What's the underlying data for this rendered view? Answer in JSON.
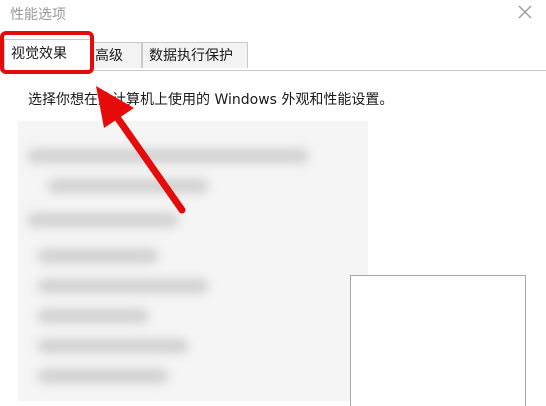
{
  "window": {
    "title": "性能选项",
    "close_icon": "close-icon"
  },
  "tabs": [
    {
      "label": "视觉效果",
      "active": true
    },
    {
      "label": "高级",
      "active": false
    },
    {
      "label": "数据执行保护",
      "active": false
    }
  ],
  "main": {
    "description": "选择你想在此计算机上使用的 Windows 外观和性能设置。"
  },
  "annotation": {
    "highlight_color": "#e60b0b",
    "arrow_icon": "red-arrow-annotation"
  }
}
